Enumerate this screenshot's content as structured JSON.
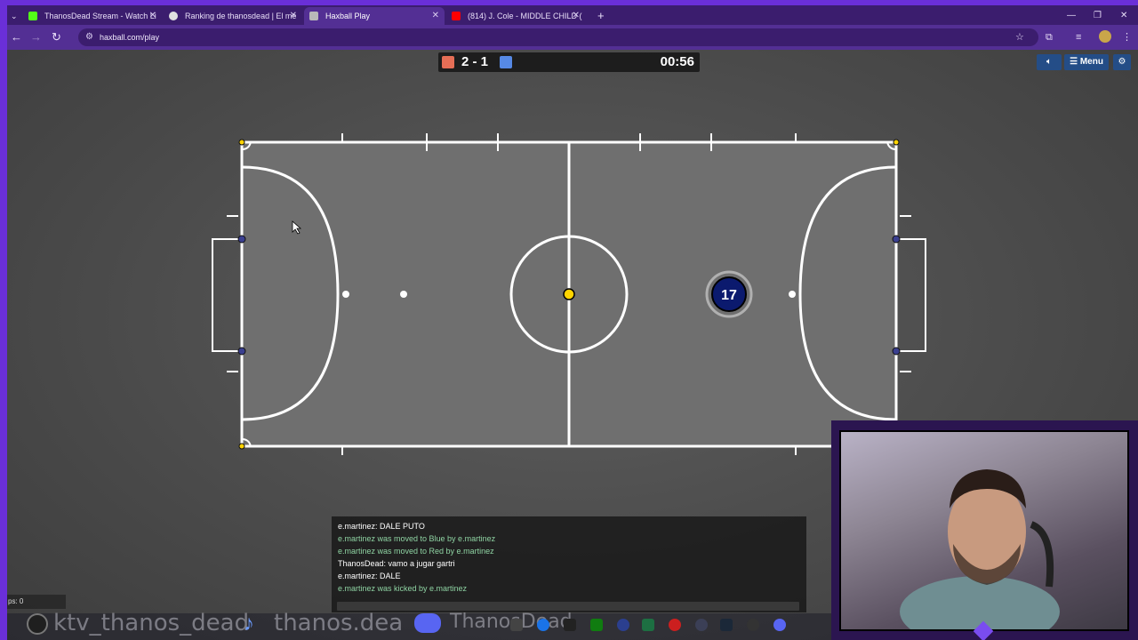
{
  "browser": {
    "tabs": [
      {
        "title": "ThanosDead Stream - Watch Li",
        "favicon_color": "#53fc18",
        "active": false
      },
      {
        "title": "Ranking de thanosdead | El me",
        "favicon_color": "#e0e0e0",
        "active": false
      },
      {
        "title": "Haxball Play",
        "favicon_color": "#b9b9b9",
        "active": true
      },
      {
        "title": "(814) J. Cole - MIDDLE CHILD (",
        "favicon_color": "#ff0000",
        "active": false
      }
    ],
    "url": "haxball.com/play"
  },
  "game": {
    "score": "2 - 1",
    "timer": "00:56",
    "red_color": "#e56e56",
    "blue_color": "#5689e5",
    "menu_label": "Menu",
    "player_number": "17",
    "ball_color": "#ffd400",
    "player_color": "#0b1a6e",
    "field_color": "#6f6f6f"
  },
  "chat": {
    "lines": [
      {
        "text": "e.martinez: DALE PUTO",
        "kind": "msg"
      },
      {
        "text": "e.martinez was moved to Blue by e.martinez",
        "kind": "notice"
      },
      {
        "text": "e.martinez was moved to Red by e.martinez",
        "kind": "notice"
      },
      {
        "text": "ThanosDead: vamo a jugar gartri",
        "kind": "msg"
      },
      {
        "text": "e.martinez: DALE",
        "kind": "msg"
      },
      {
        "text": "e.martinez was kicked by e.martinez",
        "kind": "notice"
      }
    ],
    "fps_label": "ps: 0"
  },
  "overlay": {
    "kick_handle": "ktv_thanos_dead",
    "tiktok_handle": "thanos.dea",
    "discord_text": "ThanosDead"
  }
}
